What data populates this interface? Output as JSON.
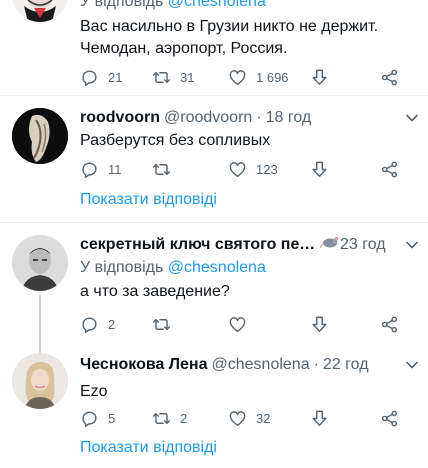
{
  "tweets": [
    {
      "reply_prefix": "У відповідь",
      "reply_mention": "@chesnolena",
      "text_lines": [
        "Вас насильно в Грузии никто не держит.",
        "Чемодан, аэропорт, Россия."
      ],
      "replies": "21",
      "retweets": "31",
      "likes": "1 696",
      "icons": [
        "comment-icon",
        "retweet-icon",
        "heart-icon",
        "downvote-icon",
        "share-icon"
      ]
    },
    {
      "name": "roodvoorn",
      "handle": "@roodvoorn",
      "separator": "·",
      "time": "18 год",
      "text": "Разберутся без сопливых",
      "replies": "11",
      "retweets": "",
      "likes": "123",
      "show_replies": "Показати відповіді"
    },
    {
      "name": "секретный ключ святого пет...",
      "emoji_desc": "rat-emoji",
      "time": "23 год",
      "reply_prefix": "У відповідь",
      "reply_mention": "@chesnolena",
      "text": "а что за заведение?",
      "replies": "2",
      "retweets": "",
      "likes": ""
    },
    {
      "name": "Чеснокова Лена",
      "handle": "@chesnolena",
      "separator": "·",
      "time": "22 год",
      "text": "Ezo",
      "replies": "5",
      "retweets": "2",
      "likes": "32",
      "show_replies": "Показати відповіді"
    }
  ],
  "colors": {
    "link": "#1d9bf0",
    "muted": "#536471",
    "text": "#0f1419",
    "divider": "#e6ecf0"
  }
}
